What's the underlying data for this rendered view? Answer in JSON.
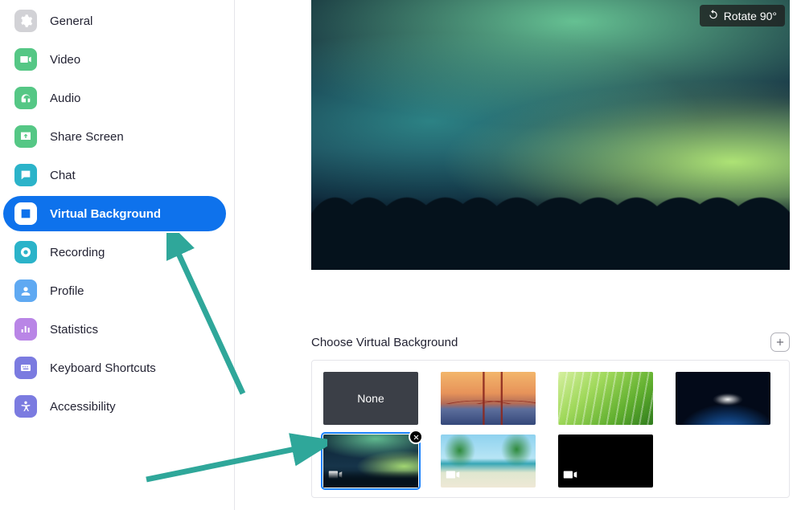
{
  "sidebar": {
    "items": [
      {
        "label": "General",
        "icon": "gear-icon",
        "color": "#d2d2d6",
        "selected": false
      },
      {
        "label": "Video",
        "icon": "video-icon",
        "color": "#55c785",
        "selected": false
      },
      {
        "label": "Audio",
        "icon": "headphones-icon",
        "color": "#55c785",
        "selected": false
      },
      {
        "label": "Share Screen",
        "icon": "share-screen-icon",
        "color": "#55c785",
        "selected": false
      },
      {
        "label": "Chat",
        "icon": "chat-icon",
        "color": "#2bb3c9",
        "selected": false
      },
      {
        "label": "Virtual Background",
        "icon": "person-card-icon",
        "color": "#0e72ec",
        "selected": true
      },
      {
        "label": "Recording",
        "icon": "record-icon",
        "color": "#2bb3c9",
        "selected": false
      },
      {
        "label": "Profile",
        "icon": "profile-icon",
        "color": "#5fa9f2",
        "selected": false
      },
      {
        "label": "Statistics",
        "icon": "statistics-icon",
        "color": "#b985e6",
        "selected": false
      },
      {
        "label": "Keyboard Shortcuts",
        "icon": "keyboard-icon",
        "color": "#7b7be0",
        "selected": false
      },
      {
        "label": "Accessibility",
        "icon": "accessibility-icon",
        "color": "#7b7be0",
        "selected": false
      }
    ]
  },
  "preview": {
    "rotate_label": "Rotate 90°",
    "current_background": "aurora"
  },
  "choose": {
    "title": "Choose Virtual Background",
    "add_tooltip": "Add"
  },
  "thumbnails": {
    "none_label": "None",
    "items": [
      {
        "id": "none",
        "label": "None",
        "is_none": true,
        "is_video": false,
        "selected": false
      },
      {
        "id": "bridge",
        "label": "Golden Gate Bridge",
        "is_none": false,
        "is_video": false,
        "selected": false
      },
      {
        "id": "grass",
        "label": "Grass",
        "is_none": false,
        "is_video": false,
        "selected": false
      },
      {
        "id": "earth",
        "label": "Earth from Space",
        "is_none": false,
        "is_video": false,
        "selected": false
      },
      {
        "id": "aurora",
        "label": "Aurora",
        "is_none": false,
        "is_video": true,
        "selected": true
      },
      {
        "id": "beach",
        "label": "Beach",
        "is_none": false,
        "is_video": true,
        "selected": false
      },
      {
        "id": "black",
        "label": "Black",
        "is_none": false,
        "is_video": true,
        "selected": false
      }
    ]
  },
  "annotations": {
    "arrow1_target": "Virtual Background sidebar item",
    "arrow2_target": "Selected aurora thumbnail",
    "arrow_color": "#2fa79a"
  }
}
